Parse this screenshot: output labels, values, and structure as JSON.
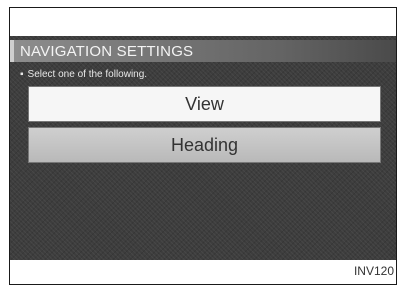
{
  "screen": {
    "title": "NAVIGATION SETTINGS",
    "instruction": "Select one of the following.",
    "bullet": "▪",
    "menu_items": [
      {
        "label": "View",
        "selected": false
      },
      {
        "label": "Heading",
        "selected": true
      }
    ]
  },
  "figure_code": "INV120"
}
